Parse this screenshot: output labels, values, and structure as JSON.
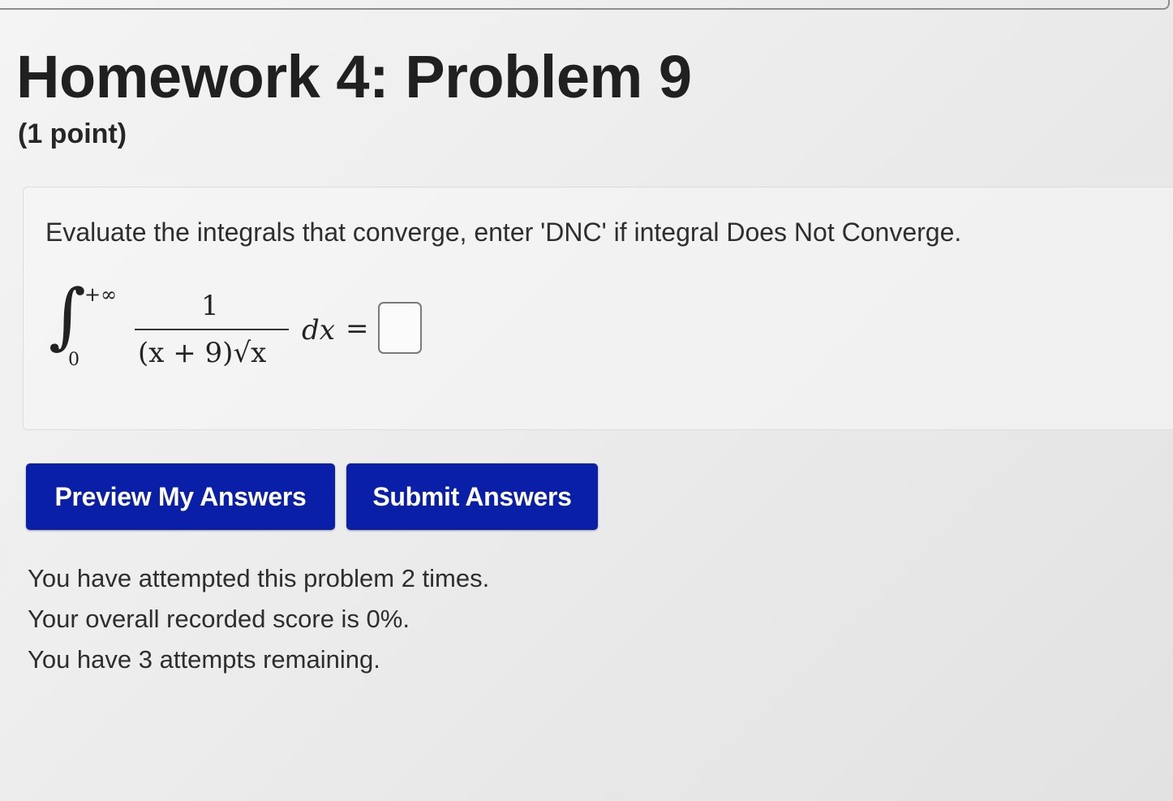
{
  "problem": {
    "title": "Homework 4: Problem 9",
    "points": "(1 point)",
    "instructions": "Evaluate the integrals that converge, enter 'DNC' if integral Does Not Converge.",
    "integral": {
      "sign": "∫",
      "upper_limit": "+∞",
      "lower_limit": "0",
      "numerator": "1",
      "denominator": "(x + 9)√x",
      "differential": "dx",
      "equals": "="
    },
    "answer": {
      "value": "",
      "placeholder": ""
    }
  },
  "buttons": {
    "preview_label": "Preview My Answers",
    "submit_label": "Submit Answers"
  },
  "status": {
    "attempts": "You have attempted this problem 2 times.",
    "score": "Your overall recorded score is 0%.",
    "remaining": "You have 3 attempts remaining."
  },
  "colors": {
    "button_bg": "#0a1fa8",
    "button_text": "#ffffff",
    "text": "#2b2b2b"
  }
}
